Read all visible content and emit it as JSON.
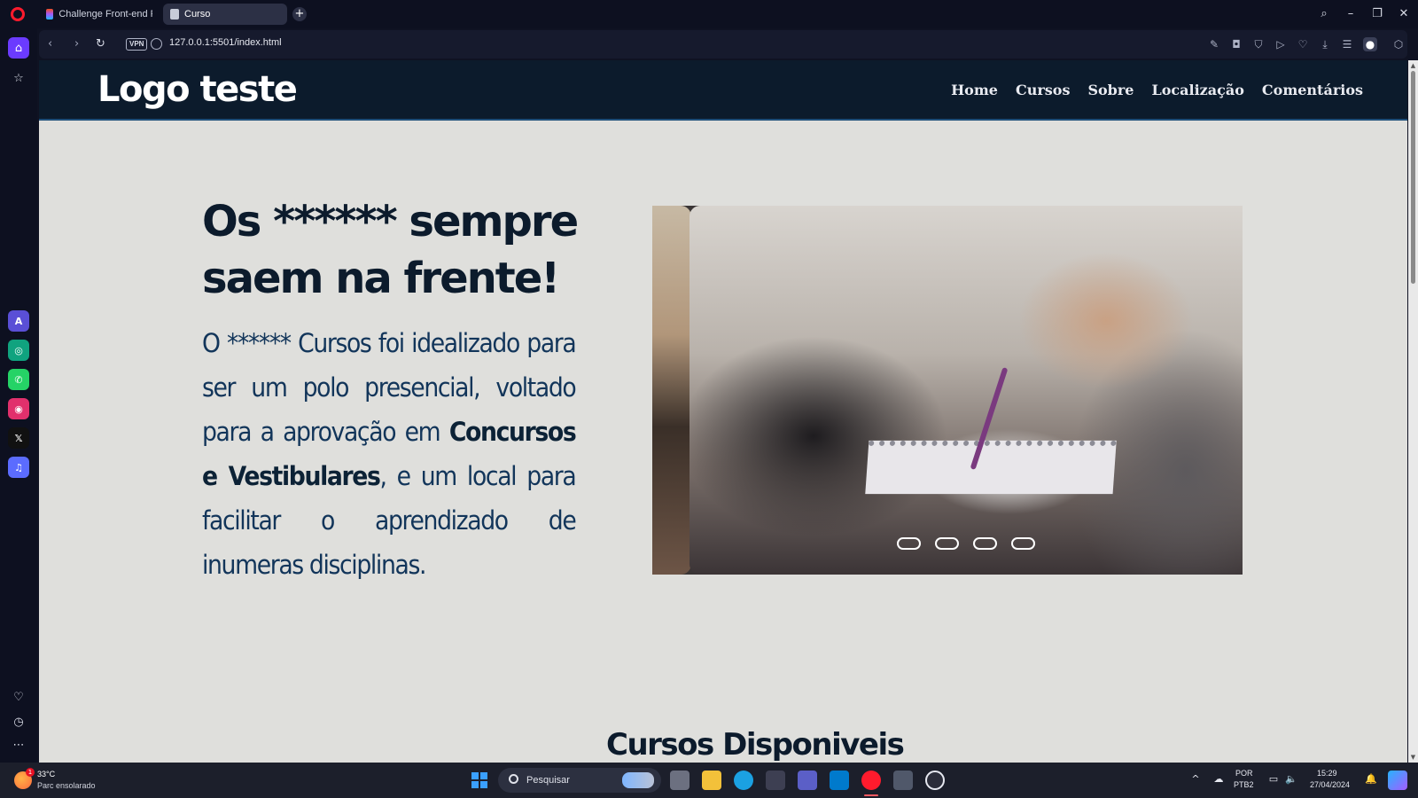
{
  "browser": {
    "tabs": [
      {
        "label": "Challenge Front-end Portf",
        "active": false
      },
      {
        "label": "Curso",
        "active": true
      }
    ],
    "new_tab": "+",
    "url": "127.0.0.1:5501/index.html",
    "vpn_label": "VPN",
    "window_controls": {
      "search": "⌕",
      "minimize": "–",
      "restore": "❐",
      "close": "✕"
    },
    "sidebar_apps": [
      {
        "name": "aria-icon",
        "glyph": "A",
        "color": "#5a4fd6"
      },
      {
        "name": "chatgpt-icon",
        "glyph": "◎",
        "color": "#10a37f"
      },
      {
        "name": "whatsapp-icon",
        "glyph": "✆",
        "color": "#25d366"
      },
      {
        "name": "instagram-icon",
        "glyph": "◉",
        "color": "#e1306c"
      },
      {
        "name": "x-icon",
        "glyph": "𝕏",
        "color": "#111111"
      },
      {
        "name": "music-icon",
        "glyph": "♫",
        "color": "#5b6cff"
      }
    ]
  },
  "site": {
    "logo": "Logo teste",
    "nav": [
      "Home",
      "Cursos",
      "Sobre",
      "Localização",
      "Comentários"
    ],
    "hero": {
      "title": "Os ****** sempre saem na frente!",
      "text_1": "O ****** Cursos foi idealizado para ser um polo presencial, voltado para a aprovação em ",
      "text_bold": "Concursos e Vestibulares",
      "text_2": ", e um local para facilitar o aprendizado de inumeras disciplinas."
    },
    "carousel": {
      "slide_count": 4,
      "active_index": 0
    },
    "section_title": "Cursos Disponiveis"
  },
  "taskbar": {
    "weather": {
      "temp": "33°C",
      "desc": "Parc ensolarado",
      "badge": "1"
    },
    "search_label": "Pesquisar",
    "lang_1": "POR",
    "lang_2": "PTB2",
    "time": "15:29",
    "date": "27/04/2024"
  }
}
